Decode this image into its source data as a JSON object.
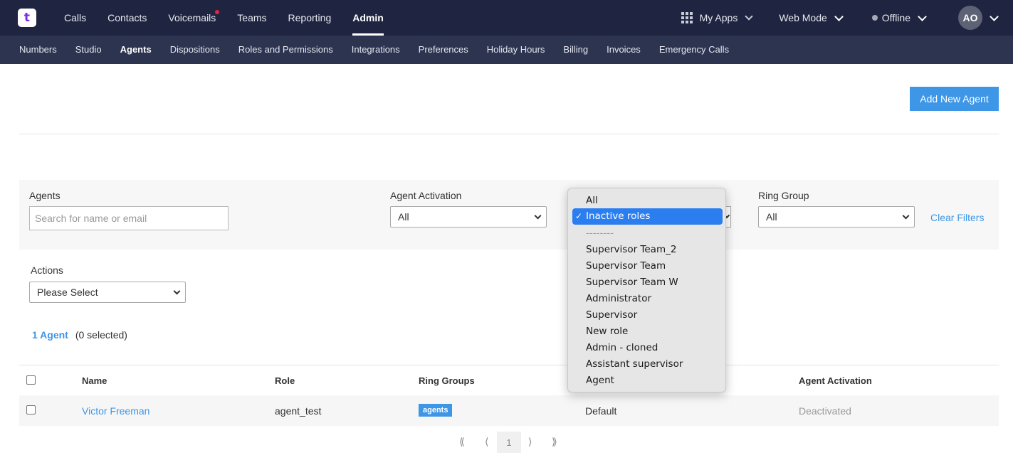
{
  "logo": {
    "glyph": "t"
  },
  "topnav": {
    "items": [
      {
        "label": "Calls"
      },
      {
        "label": "Contacts"
      },
      {
        "label": "Voicemails"
      },
      {
        "label": "Teams"
      },
      {
        "label": "Reporting"
      },
      {
        "label": "Admin"
      }
    ],
    "active": "Admin",
    "my_apps": "My Apps",
    "web_mode": "Web Mode",
    "status": "Offline",
    "avatar_initials": "AO"
  },
  "subnav": {
    "items": [
      {
        "label": "Numbers"
      },
      {
        "label": "Studio"
      },
      {
        "label": "Agents"
      },
      {
        "label": "Dispositions"
      },
      {
        "label": "Roles and Permissions"
      },
      {
        "label": "Integrations"
      },
      {
        "label": "Preferences"
      },
      {
        "label": "Holiday Hours"
      },
      {
        "label": "Billing"
      },
      {
        "label": "Invoices"
      },
      {
        "label": "Emergency Calls"
      }
    ],
    "active": "Agents"
  },
  "add_button": "Add New Agent",
  "filters": {
    "agents_label": "Agents",
    "agents_placeholder": "Search for name or email",
    "activation_label": "Agent Activation",
    "activation_value": "All",
    "ring_group_label": "Ring Group",
    "ring_group_value": "All",
    "clear_filters": "Clear Filters",
    "actions_label": "Actions",
    "actions_value": "Please Select"
  },
  "summary": {
    "count": "1 Agent",
    "selected": "(0 selected)"
  },
  "table": {
    "headers": {
      "name": "Name",
      "role": "Role",
      "ring_groups": "Ring Groups",
      "activation": "Agent Activation"
    },
    "rows": [
      {
        "name": "Victor Freeman",
        "role": "agent_test",
        "ring_group": "agents",
        "team": "Default",
        "activation": "Deactivated"
      }
    ]
  },
  "pagination": {
    "first": "⟪",
    "prev": "⟨",
    "current": "1",
    "next": "⟩",
    "last": "⟫"
  },
  "role_dropdown": {
    "options": [
      "All",
      "Inactive roles",
      "--------",
      "Supervisor Team_2",
      "Supervisor Team",
      "Supervisor Team W",
      "Administrator",
      "Supervisor",
      "New role",
      "Admin - cloned",
      "Assistant supervisor",
      "Agent"
    ],
    "selected": "Inactive roles",
    "check": "✓"
  },
  "colors": {
    "topbar": "#1f2540",
    "subnav": "#2c3450",
    "accent": "#3d96e6",
    "dropdown_highlight": "#2a7ef0"
  }
}
